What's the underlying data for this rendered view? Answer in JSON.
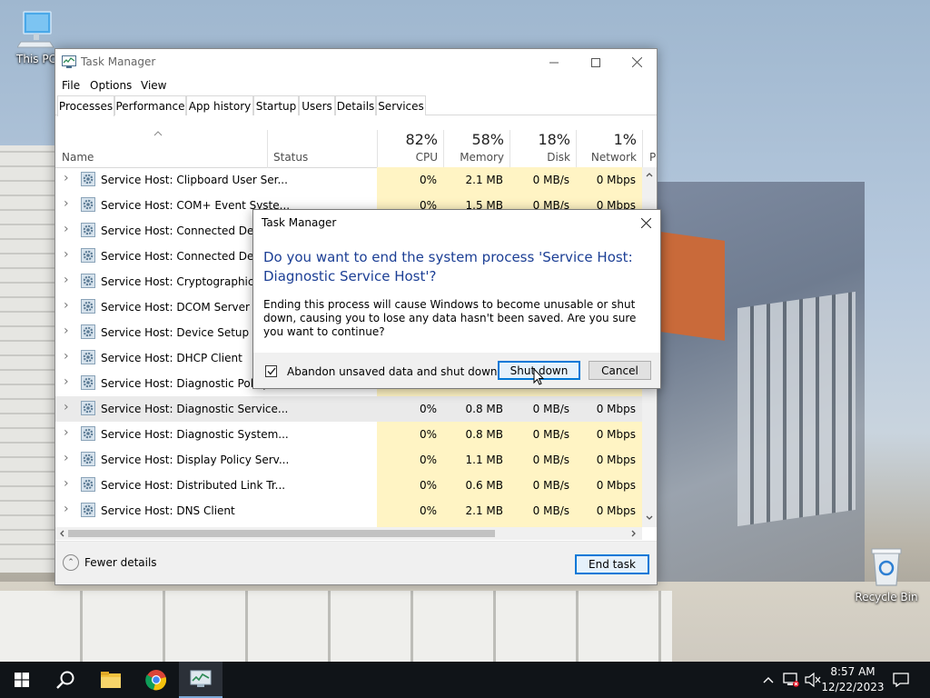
{
  "desktop": {
    "icons": [
      {
        "label": "This PC",
        "icon": "computer-icon"
      },
      {
        "label": "Recycle Bin",
        "icon": "recycle-bin-icon"
      }
    ]
  },
  "task_manager": {
    "title": "Task Manager",
    "menu": [
      "File",
      "Options",
      "View"
    ],
    "tabs": [
      "Processes",
      "Performance",
      "App history",
      "Startup",
      "Users",
      "Details",
      "Services"
    ],
    "active_tab": "Processes",
    "columns": {
      "name": "Name",
      "status": "Status",
      "cpu": {
        "pct": "82%",
        "label": "CPU"
      },
      "memory": {
        "pct": "58%",
        "label": "Memory"
      },
      "disk": {
        "pct": "18%",
        "label": "Disk"
      },
      "network": {
        "pct": "1%",
        "label": "Network"
      },
      "power": "P"
    },
    "rows": [
      {
        "name": "Service Host: Clipboard User Ser...",
        "cpu": "0%",
        "memory": "2.1 MB",
        "disk": "0 MB/s",
        "network": "0 Mbps"
      },
      {
        "name": "Service Host: COM+ Event Syste...",
        "cpu": "0%",
        "memory": "1.5 MB",
        "disk": "0 MB/s",
        "network": "0 Mbps"
      },
      {
        "name": "Service Host: Connected Device",
        "cpu": "",
        "memory": "",
        "disk": "",
        "network": ""
      },
      {
        "name": "Service Host: Connected Device",
        "cpu": "",
        "memory": "",
        "disk": "",
        "network": ""
      },
      {
        "name": "Service Host: Cryptographic Ser",
        "cpu": "",
        "memory": "",
        "disk": "",
        "network": ""
      },
      {
        "name": "Service Host: DCOM Server Proc",
        "cpu": "",
        "memory": "",
        "disk": "",
        "network": ""
      },
      {
        "name": "Service Host: Device Setup Mana",
        "cpu": "",
        "memory": "",
        "disk": "",
        "network": ""
      },
      {
        "name": "Service Host: DHCP Client",
        "cpu": "",
        "memory": "",
        "disk": "",
        "network": ""
      },
      {
        "name": "Service Host: Diagnostic Policy",
        "cpu": "",
        "memory": "",
        "disk": "",
        "network": ""
      },
      {
        "name": "Service Host: Diagnostic Service...",
        "cpu": "0%",
        "memory": "0.8 MB",
        "disk": "0 MB/s",
        "network": "0 Mbps",
        "selected": true
      },
      {
        "name": "Service Host: Diagnostic System...",
        "cpu": "0%",
        "memory": "0.8 MB",
        "disk": "0 MB/s",
        "network": "0 Mbps"
      },
      {
        "name": "Service Host: Display Policy Serv...",
        "cpu": "0%",
        "memory": "1.1 MB",
        "disk": "0 MB/s",
        "network": "0 Mbps"
      },
      {
        "name": "Service Host: Distributed Link Tr...",
        "cpu": "0%",
        "memory": "0.6 MB",
        "disk": "0 MB/s",
        "network": "0 Mbps"
      },
      {
        "name": "Service Host: DNS Client",
        "cpu": "0%",
        "memory": "2.1 MB",
        "disk": "0 MB/s",
        "network": "0 Mbps"
      }
    ],
    "fewer_details": "Fewer details",
    "end_task": "End task"
  },
  "dialog": {
    "title": "Task Manager",
    "heading": "Do you want to end the system process 'Service Host: Diagnostic Service Host'?",
    "body": "Ending this process will cause Windows to become unusable or shut down, causing you to lose any data hasn't been saved. Are you sure you want to continue?",
    "checkbox_label": "Abandon unsaved data and shut down.",
    "checkbox_checked": true,
    "shutdown_button": "Shut down",
    "cancel_button": "Cancel"
  },
  "taskbar": {
    "items": [
      "start-icon",
      "search-icon",
      "file-explorer-icon",
      "chrome-icon",
      "task-manager-icon"
    ],
    "time": "8:57 AM",
    "date": "12/22/2023"
  },
  "colors": {
    "accent": "#0078d7",
    "heading": "#1c3f95",
    "heat": "#fff4c4",
    "taskbar": "#101418"
  }
}
